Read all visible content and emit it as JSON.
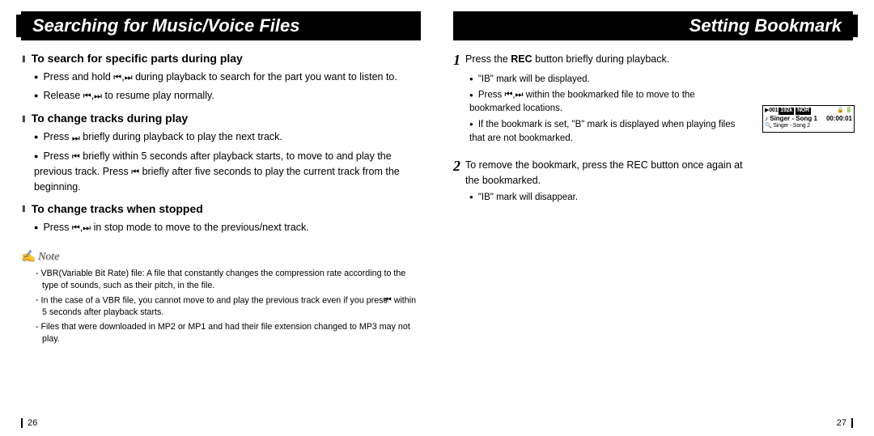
{
  "left": {
    "title": "Searching for Music/Voice Files",
    "s1": {
      "heading": "To search for specific parts during play",
      "b1_a": "Press and hold ",
      "b1_b": " during playback to search for the part you want to listen to.",
      "b2_a": "Release ",
      "b2_b": " to resume play normally."
    },
    "s2": {
      "heading": "To change tracks during play",
      "b1_a": "Press ",
      "b1_b": " briefly during playback to play the next track.",
      "b2_a": "Press ",
      "b2_b": " briefly within 5 seconds after playback starts, to move to and play the previous track. Press ",
      "b2_c": " briefly after five seconds to play the current track from the beginning."
    },
    "s3": {
      "heading": "To change tracks when stopped",
      "b1_a": "Press ",
      "b1_b": " in stop mode to move to the previous/next track."
    },
    "note": {
      "label": "Note",
      "n1": "VBR(Variable Bit Rate) file: A file that constantly changes the compression rate according to the type of sounds, such as their pitch, in the file.",
      "n2_a": "In the case of a VBR file, you cannot move to and play the previous track even if you press ",
      "n2_b": " within 5 seconds after playback starts.",
      "n3": "Files that were downloaded in MP2 or MP1 and had their file extension changed to MP3 may not play."
    },
    "page": "26"
  },
  "right": {
    "title": "Setting Bookmark",
    "step1": {
      "num": "1",
      "text_a": "Press the ",
      "text_b": "REC",
      "text_c": " button briefly during playback.",
      "b1": "\"IB\" mark will be displayed.",
      "b2_a": "Press ",
      "b2_b": " within the bookmarked file to move to the bookmarked locations.",
      "b3": "If the bookmark is set, \"B\" mark is displayed when playing files that are not bookmarked."
    },
    "step2": {
      "num": "2",
      "text": "To remove the bookmark, press the REC button once again at the bookmarked.",
      "b1": "\"IB\" mark will disappear."
    },
    "lcd": {
      "track": "001",
      "bitrate": "192k",
      "mode": "NOR",
      "line1_a": "Singer - Song 1",
      "time": "00:00:01",
      "line2": "Singer - Song 2"
    },
    "page": "27"
  }
}
